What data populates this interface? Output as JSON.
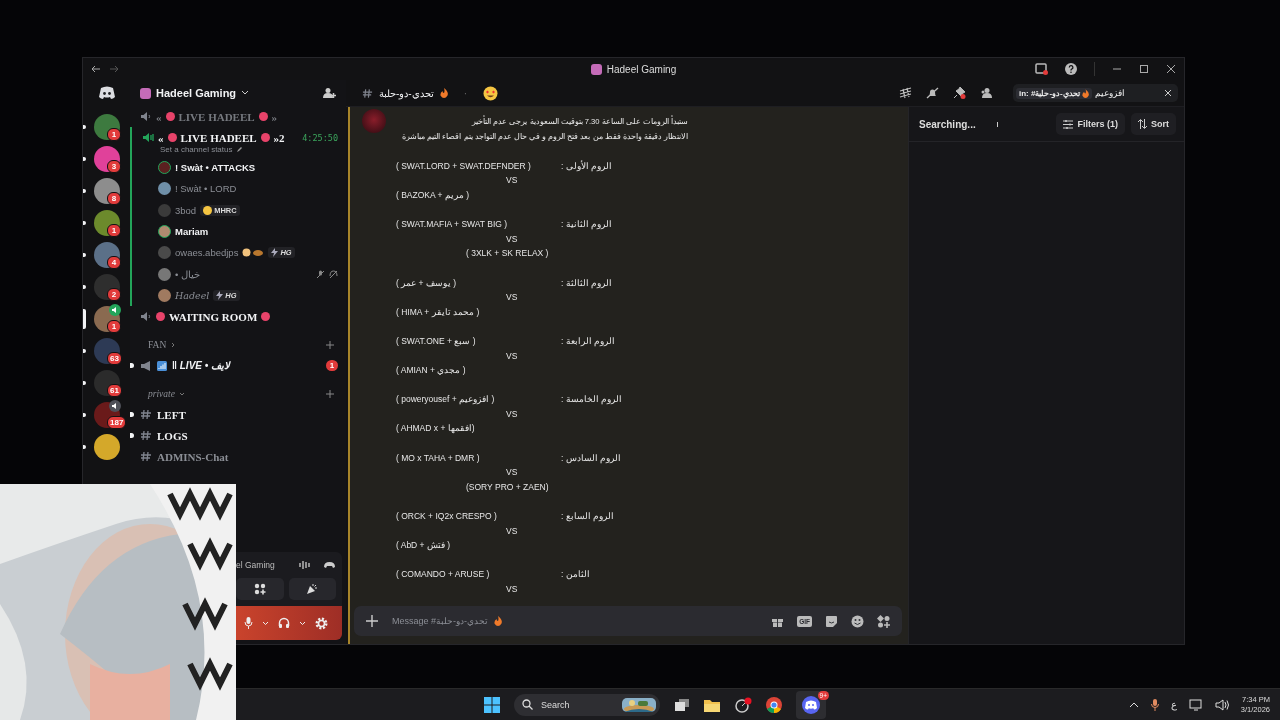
{
  "window": {
    "title": "Hadeel Gaming"
  },
  "servers": [
    {
      "badge": "1",
      "selected": false,
      "voice": false
    },
    {
      "badge": "3",
      "selected": false,
      "voice": false
    },
    {
      "badge": "8",
      "selected": false,
      "voice": false
    },
    {
      "badge": "1",
      "selected": false,
      "voice": false
    },
    {
      "badge": "4",
      "selected": false,
      "voice": false
    },
    {
      "badge": "2",
      "selected": false,
      "voice": false
    },
    {
      "badge": "1",
      "selected": true,
      "voice": true
    },
    {
      "badge": "63",
      "selected": false,
      "voice": false
    },
    {
      "badge": "61",
      "selected": false,
      "voice": false
    },
    {
      "badge": "187",
      "selected": false,
      "voice": true
    },
    {
      "selected": false,
      "voice": false
    }
  ],
  "server_header": {
    "name": "Hadeel Gaming"
  },
  "channels": [
    {
      "kind": "voice",
      "prefix": "«",
      "name": "LIVE HADEEL",
      "suffix": "»",
      "connected": false
    },
    {
      "kind": "voice",
      "prefix": "«",
      "name": "LIVE HADEEL",
      "suffix": "»2",
      "connected": true,
      "timer": "4:25:50",
      "status": "Set a channel status",
      "children": [
        {
          "name": "! Swàt • ATTACKS",
          "speaking": true,
          "dimmed": false,
          "muted": false
        },
        {
          "name": "! Swàt • LORD",
          "speaking": false,
          "dimmed": true,
          "muted": false
        },
        {
          "name": "3bod",
          "tag": {
            "kind": "emoji",
            "text": "MHRC"
          },
          "speaking": false,
          "dimmed": true,
          "muted": false
        },
        {
          "name": "Mariam",
          "speaking": true,
          "dimmed": false,
          "muted": false
        },
        {
          "name": "owaes.abedjps",
          "tag": {
            "kind": "bolt",
            "text": "HG"
          },
          "extra_emoji": true,
          "speaking": false,
          "dimmed": true,
          "muted": false
        },
        {
          "name": "• خيال",
          "speaking": false,
          "dimmed": true,
          "muted": true
        },
        {
          "name": "Hadeel",
          "tag": {
            "kind": "bolt",
            "text": "HG"
          },
          "fancy": true,
          "speaking": false,
          "dimmed": true,
          "muted": false
        }
      ]
    },
    {
      "kind": "voice",
      "name": "WAITING ROOM",
      "connected": false
    },
    {
      "kind": "category",
      "name": "FAN",
      "expanded": false
    },
    {
      "kind": "announcement",
      "name": "‖ LIVE • لايف",
      "unread": true,
      "badge": "1"
    },
    {
      "kind": "category",
      "name": "private",
      "expanded": true
    },
    {
      "kind": "text",
      "name": "LEFT",
      "unread": true
    },
    {
      "kind": "text",
      "name": "LOGS",
      "unread": true
    },
    {
      "kind": "text",
      "name": "ADMINS-Chat",
      "unread": false
    }
  ],
  "voice_panel": {
    "server": "el Gaming"
  },
  "channel_header": {
    "name": "تحدي-دو-حلبة",
    "separator": "·"
  },
  "message": {
    "lines": [
      {
        "kind": "text",
        "text": "ستبدأ الرومات على الساعة 7.30 بتوقيت السعودية يرجى عدم التأخير"
      },
      {
        "kind": "text",
        "text": "الانتظار دقيقة واحدة فقط من بعد فتح الروم و في حال عدم التواجد يتم اقصاء التيم مباشرة"
      },
      {
        "kind": "blank"
      },
      {
        "kind": "pair",
        "team": "( SWAT.LORD + SWAT.DEFNDER )",
        "label": "الروم الأولى :"
      },
      {
        "kind": "vs",
        "text": "VS"
      },
      {
        "kind": "team",
        "text": "( BAZOKA + مريم )",
        "indent": false
      },
      {
        "kind": "blank"
      },
      {
        "kind": "pair",
        "team": "( SWAT.MAFIA + SWAT BIG )",
        "label": "الروم الثانية :"
      },
      {
        "kind": "vs",
        "text": "VS"
      },
      {
        "kind": "team",
        "text": "( 3XLK + SK RELAX )",
        "indent": true
      },
      {
        "kind": "blank"
      },
      {
        "kind": "pair",
        "team": "( يوسف + عمر )",
        "label": "الروم الثالثة :"
      },
      {
        "kind": "vs",
        "text": "VS"
      },
      {
        "kind": "team",
        "text": "( HIMA + محمد تايقر )",
        "indent": false
      },
      {
        "kind": "blank"
      },
      {
        "kind": "pair",
        "team": "( SWAT.ONE + سبع )",
        "label": "الروم الرابعة :"
      },
      {
        "kind": "vs",
        "text": "VS"
      },
      {
        "kind": "team",
        "text": "( AMIAN + مجدي )",
        "indent": false
      },
      {
        "kind": "blank"
      },
      {
        "kind": "pair",
        "team": "( poweryousef + افزوعيم )",
        "label": "الروم الخامسة :"
      },
      {
        "kind": "vs",
        "text": "VS"
      },
      {
        "kind": "team",
        "text": "( AHMAD x + افقمها)",
        "indent": false
      },
      {
        "kind": "blank"
      },
      {
        "kind": "pair",
        "team": "( MO x TAHA + DMR )",
        "label": "الروم السادس :"
      },
      {
        "kind": "vs",
        "text": "VS"
      },
      {
        "kind": "team",
        "text": "(SORY PRO + ZAEN)",
        "indent": true
      },
      {
        "kind": "blank"
      },
      {
        "kind": "pair",
        "team": "( ORCK + IQ2x CRESPO )",
        "label": "الروم السابع :"
      },
      {
        "kind": "vs",
        "text": "VS"
      },
      {
        "kind": "team",
        "text": "( AbD + فتش )",
        "indent": false
      },
      {
        "kind": "blank"
      },
      {
        "kind": "pair",
        "team": "( COMANDO + ARUSE )",
        "label": "الثامن :"
      },
      {
        "kind": "vs",
        "text": "VS"
      }
    ]
  },
  "composer": {
    "placeholder": "Message #تحدي-دو-حلبة",
    "gif": "GIF"
  },
  "search": {
    "scope": "in: #تحدي-دو-حلبة",
    "value": "افزوعيم"
  },
  "search_panel": {
    "status": "Searching...",
    "filters": "Filters (1)",
    "sort": "Sort"
  },
  "taskbar": {
    "search": "Search",
    "language": "ع",
    "time": "7:34 PM",
    "date": "3/1/2026",
    "discord_badge": "9+"
  }
}
